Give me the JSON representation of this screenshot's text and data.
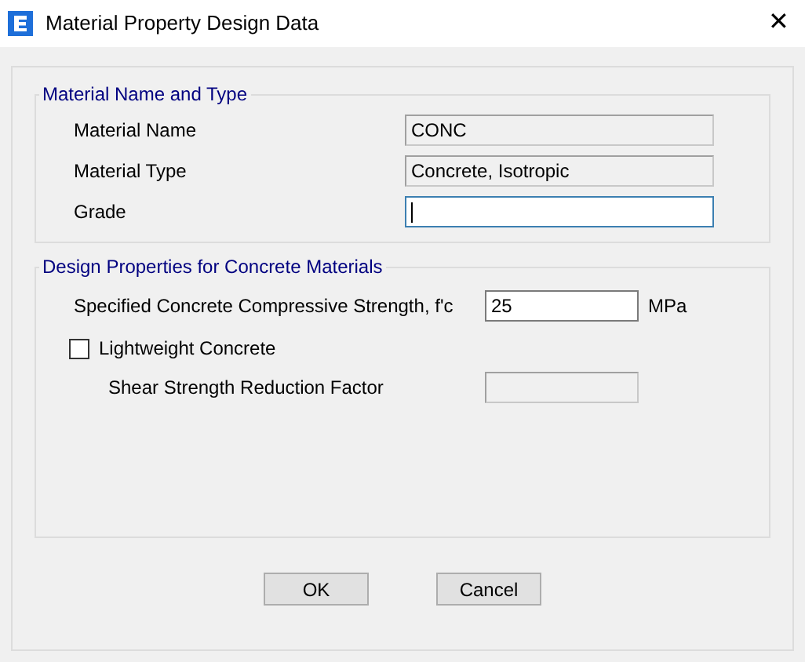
{
  "window": {
    "title": "Material Property Design Data",
    "close": "✕"
  },
  "name_group": {
    "legend": "Material Name and Type",
    "fields": [
      {
        "label": "Material Name",
        "value": "CONC",
        "disabled": true,
        "focused": false
      },
      {
        "label": "Material Type",
        "value": "Concrete, Isotropic",
        "disabled": true,
        "focused": false
      },
      {
        "label": "Grade",
        "disabled": false,
        "focused": true
      }
    ]
  },
  "design_group": {
    "legend": "Design Properties for Concrete Materials",
    "strength": {
      "label": "Specified Concrete Compressive Strength, f'c",
      "value": "25",
      "unit": "MPa"
    },
    "lightweight": {
      "label": "Lightweight Concrete",
      "checked": false
    },
    "shear": {
      "label": "Shear Strength Reduction Factor",
      "disabled": true
    }
  },
  "buttons": [
    "OK",
    "Cancel"
  ]
}
